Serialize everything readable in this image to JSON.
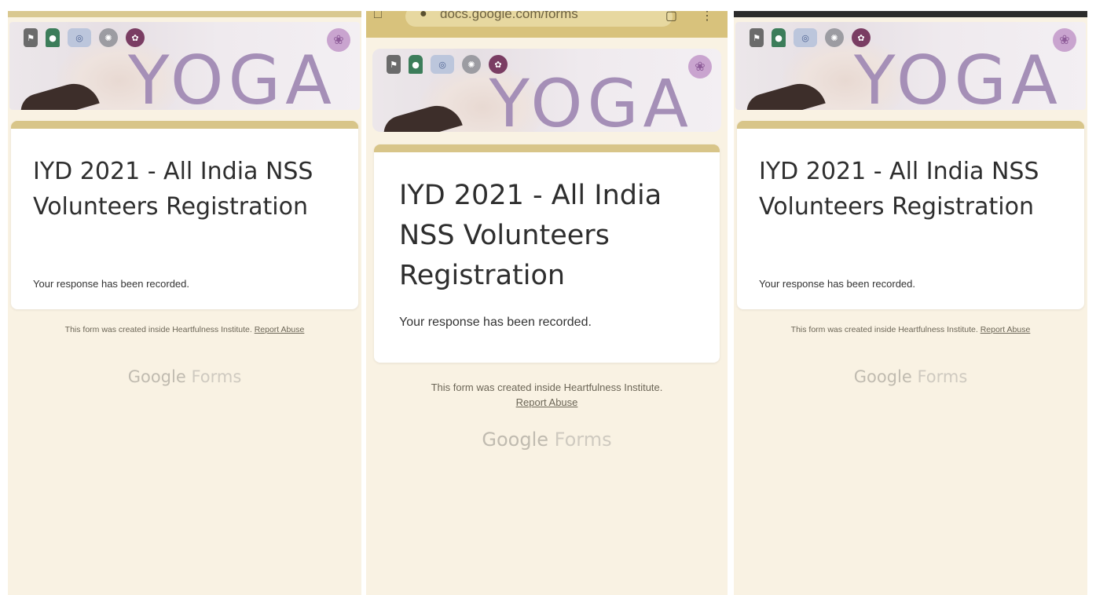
{
  "url_bar": {
    "text": "docs.google.com/forms"
  },
  "banner": {
    "word": "YOGA"
  },
  "form": {
    "title": "IYD 2021 - All India NSS Volunteers Registration",
    "response": "Your response has been recorded.",
    "created_note": "This form was created inside Heartfulness Institute.",
    "report_abuse": "Report Abuse",
    "google": "Google",
    "forms": "Forms"
  },
  "colors": {
    "page_background": "#f9f2e3",
    "card_accent": "#d8c589",
    "yoga_text": "#a58fb7",
    "url_bar": "#d8c27c"
  },
  "icons": [
    "emblem-icon",
    "figure-logo-icon",
    "un-logo-icon",
    "seal-logo-icon",
    "purple-logo-icon",
    "yoga-corner-logo-icon"
  ]
}
